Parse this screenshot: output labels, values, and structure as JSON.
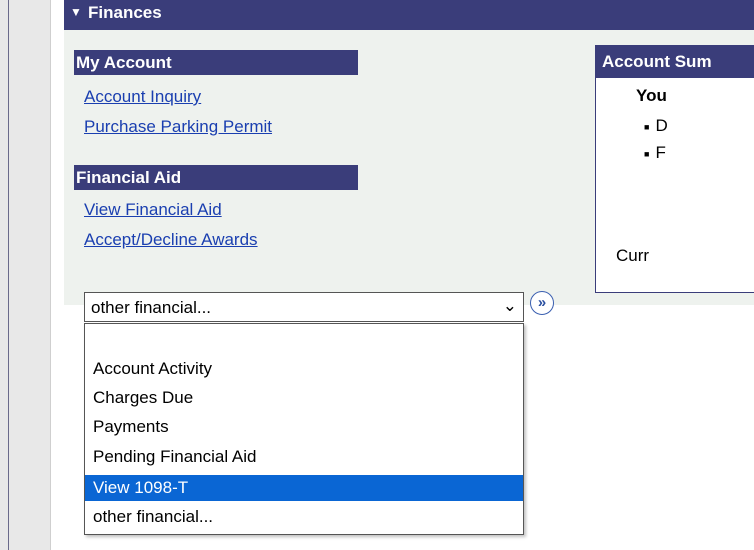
{
  "finances": {
    "title": "Finances",
    "my_account": {
      "heading": "My Account",
      "links": [
        "Account Inquiry",
        "Purchase Parking Permit"
      ]
    },
    "financial_aid": {
      "heading": "Financial Aid",
      "links": [
        "View Financial Aid",
        "Accept/Decline Awards"
      ]
    },
    "select": {
      "value": "other financial...",
      "go_label": "»",
      "options": [
        "",
        "Account Activity",
        "Charges Due",
        "Payments",
        "Pending Financial Aid",
        "View 1098-T",
        "other financial..."
      ],
      "highlighted": "View 1098-T"
    },
    "account_summary": {
      "heading": "Account Sum",
      "you": "You",
      "bullets": [
        "D",
        "F"
      ],
      "curr": "Curr"
    }
  },
  "colors": {
    "header": "#3a3d7a",
    "link": "#1a3fb0",
    "highlight": "#0a66d4"
  }
}
